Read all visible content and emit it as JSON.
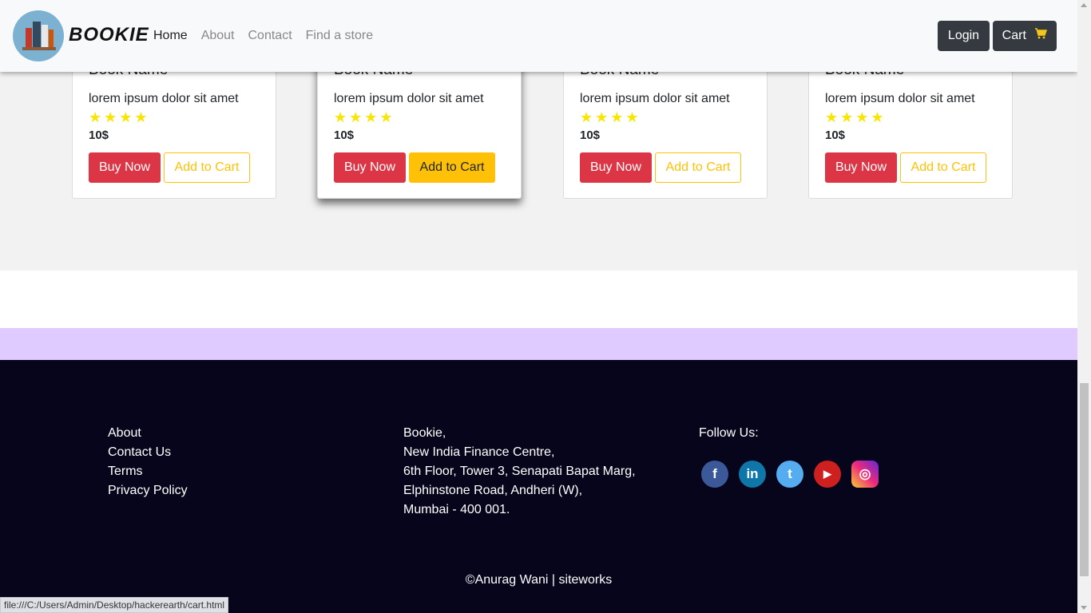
{
  "navbar": {
    "brand": "BOOKIE",
    "links": [
      {
        "label": "Home",
        "active": true
      },
      {
        "label": "About",
        "active": false
      },
      {
        "label": "Contact",
        "active": false
      },
      {
        "label": "Find a store",
        "active": false
      }
    ],
    "login_label": "Login",
    "cart_label": "Cart"
  },
  "products": [
    {
      "name": "Book Name",
      "desc": "lorem ipsum dolor sit amet",
      "stars": "★★★★",
      "rating": 4,
      "price": "10$",
      "buy_label": "Buy Now",
      "cart_label": "Add to Cart"
    },
    {
      "name": "Book Name",
      "desc": "lorem ipsum dolor sit amet",
      "stars": "★★★★",
      "rating": 4,
      "price": "10$",
      "buy_label": "Buy Now",
      "cart_label": "Add to Cart"
    },
    {
      "name": "Book Name",
      "desc": "lorem ipsum dolor sit amet",
      "stars": "★★★★",
      "rating": 4,
      "price": "10$",
      "buy_label": "Buy Now",
      "cart_label": "Add to Cart"
    },
    {
      "name": "Book Name",
      "desc": "lorem ipsum dolor sit amet",
      "stars": "★★★★",
      "rating": 4,
      "price": "10$",
      "buy_label": "Buy Now",
      "cart_label": "Add to Cart"
    }
  ],
  "footer": {
    "links": [
      "About",
      "Contact Us",
      "Terms",
      "Privacy Policy"
    ],
    "address": [
      "Bookie,",
      "New India Finance Centre,",
      "6th Floor, Tower 3, Senapati Bapat Marg,",
      "Elphinstone Road, Andheri (W),",
      "Mumbai - 400 001."
    ],
    "follow_label": "Follow Us:",
    "social": [
      {
        "icon": "facebook-icon",
        "glyph": "f",
        "color": "#3b5998"
      },
      {
        "icon": "linkedin-icon",
        "glyph": "in",
        "color": "#0e76a8"
      },
      {
        "icon": "twitter-icon",
        "glyph": "t",
        "color": "#55acee"
      },
      {
        "icon": "youtube-icon",
        "glyph": "▶",
        "color": "#cd201f"
      },
      {
        "icon": "instagram-icon",
        "glyph": "◎",
        "color": "#c13584"
      }
    ],
    "copyright": "©Anurag Wani | siteworks"
  },
  "status_url": "file:///C:/Users/Admin/Desktop/hackerearth/cart.html",
  "colors": {
    "buy": "#dc3545",
    "cart": "#ffc107",
    "footer_bg": "#07051c",
    "lavender": "#dfcbff",
    "star": "#f6e600"
  }
}
